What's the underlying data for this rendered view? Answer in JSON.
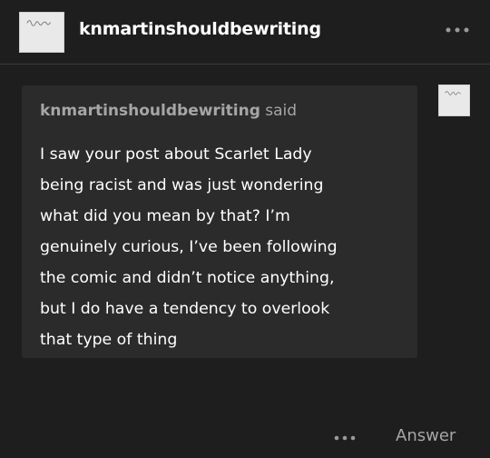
{
  "header": {
    "blog_name": "knmartinshouldbewriting",
    "more_icon": "ellipsis-icon"
  },
  "ask": {
    "asker_name": "knmartinshouldbewriting",
    "said_label": "said",
    "question_lines": [
      "I saw your post about Scarlet Lady",
      "being racist and was just wondering",
      "what did you mean by that? I’m",
      "genuinely curious, I’ve been following",
      "the comic and didn’t notice anything,",
      "but I do have a tendency to overlook",
      "that type of thing"
    ]
  },
  "footer": {
    "more_icon": "ellipsis-icon",
    "answer_label": "Answer"
  },
  "colors": {
    "background": "#1e1e1e",
    "ask_box": "#2b2b2b",
    "muted_text": "#a6a6a6",
    "text": "#ffffff",
    "avatar": "#e9e9e9"
  }
}
